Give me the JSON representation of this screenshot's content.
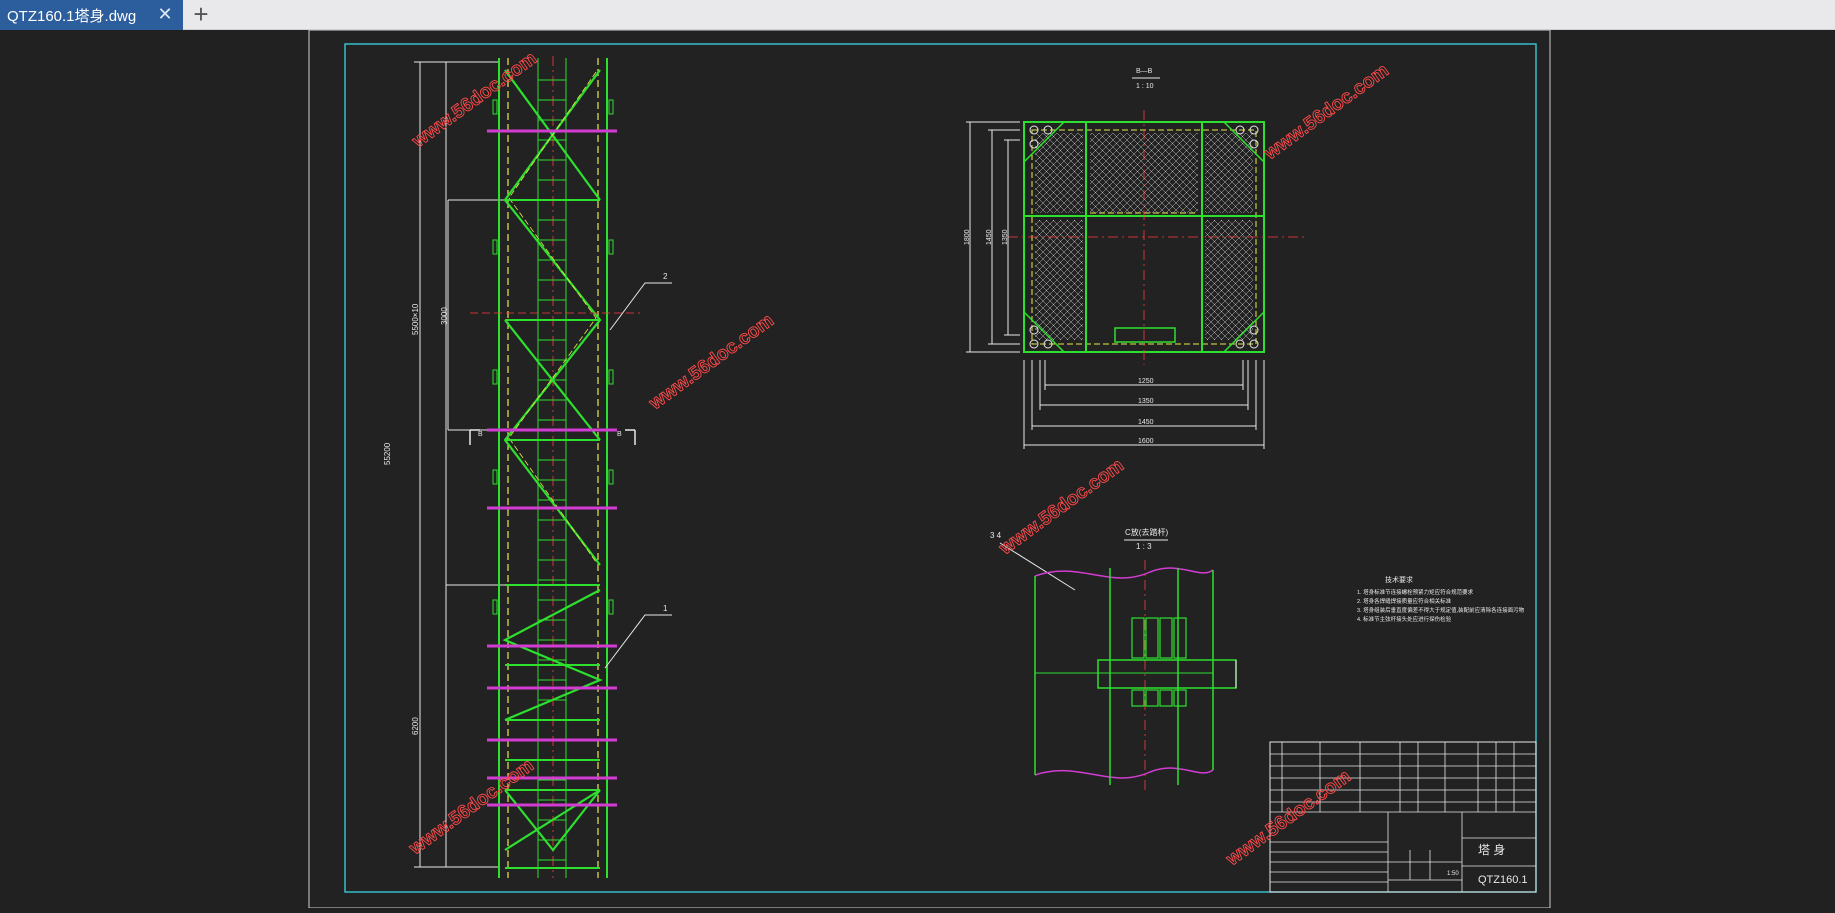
{
  "tab": {
    "title": "QTZ160.1塔身.dwg",
    "close_glyph": "✕",
    "new_tab_glyph": "+"
  },
  "drawing": {
    "section_label": "B—B",
    "section_scale": "1 : 10",
    "detail_label": "C放(去踏杆)",
    "detail_scale": "1 : 3",
    "dim_overall": "55200",
    "dim_upper": "5500×10",
    "dim_panel": "3000",
    "dim_lower": "6200",
    "dim_w1": "1250",
    "dim_w2": "1350",
    "dim_w3": "1450",
    "dim_w4": "1600",
    "dim_h1": "1800",
    "dim_h2": "1450",
    "dim_h3": "1350",
    "callout_1": "1",
    "callout_2": "2",
    "callout_b_left": "B",
    "callout_b_right": "B",
    "callout_34": "3  4",
    "tech_title": "技术要求",
    "tech_notes": [
      "1. 塔身标准节连接螺栓预紧力矩应符合规范要求",
      "2. 塔身各焊缝焊接质量应符合相关标准",
      "3. 塔身组装后垂直度偏差不得大于规定值,装配前应清除各连接面污物",
      "4. 标准节主弦杆接头处应进行探伤检验"
    ],
    "title_name": "塔 身",
    "title_code": "QTZ160.1",
    "scale_cell": "1:50",
    "watermark": "www.56doc.com"
  }
}
